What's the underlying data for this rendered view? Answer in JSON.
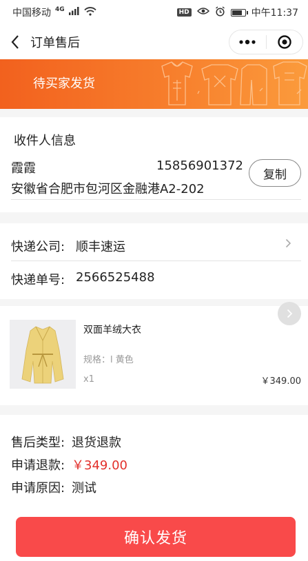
{
  "status_bar": {
    "carrier": "中国移动",
    "network": "4G",
    "hd_badge": "HD",
    "time": "中午11:37"
  },
  "nav": {
    "title": "订单售后"
  },
  "banner": {
    "status_text": "待买家发货",
    "background_start": "#f2611e",
    "background_end": "#fb9b3c"
  },
  "receiver": {
    "section_title": "收件人信息",
    "name": "霞霞",
    "phone": "15856901372",
    "address": "安徽省合肥市包河区金融港A2-202",
    "copy_label": "复制"
  },
  "express": {
    "company_label": "快递公司:",
    "company_value": "顺丰速运",
    "number_label": "快递单号:",
    "number_value": "2566525488"
  },
  "product": {
    "name": "双面羊绒大衣",
    "spec": "规格：l 黄色",
    "quantity": "x1",
    "price": "￥349.00"
  },
  "after_sale": {
    "type_label": "售后类型:",
    "type_value": "退货退款",
    "refund_label": "申请退款:",
    "refund_value": "￥349.00",
    "reason_label": "申请原因:",
    "reason_value": "测试",
    "refund_color": "#e2302b"
  },
  "footer": {
    "confirm_label": "确认发货",
    "button_color": "#f94a4a"
  }
}
